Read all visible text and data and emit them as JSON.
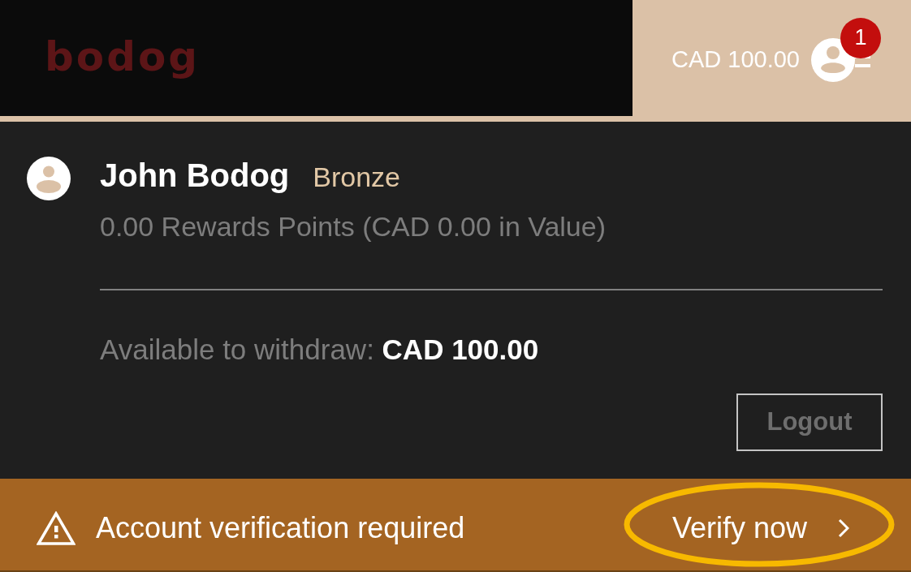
{
  "header": {
    "logo": "bodog",
    "balance": "CAD 100.00",
    "notification_count": "1"
  },
  "profile": {
    "name": "John Bodog",
    "tier": "Bronze",
    "rewards": "0.00 Rewards Points (CAD 0.00 in Value)",
    "withdraw": "Available to withdraw: **CAD 100.00**",
    "logout": "Logout"
  },
  "banner": {
    "message": "Account verification required",
    "action": {
      "label": "Verify now",
      "highlighted": true
    }
  }
}
